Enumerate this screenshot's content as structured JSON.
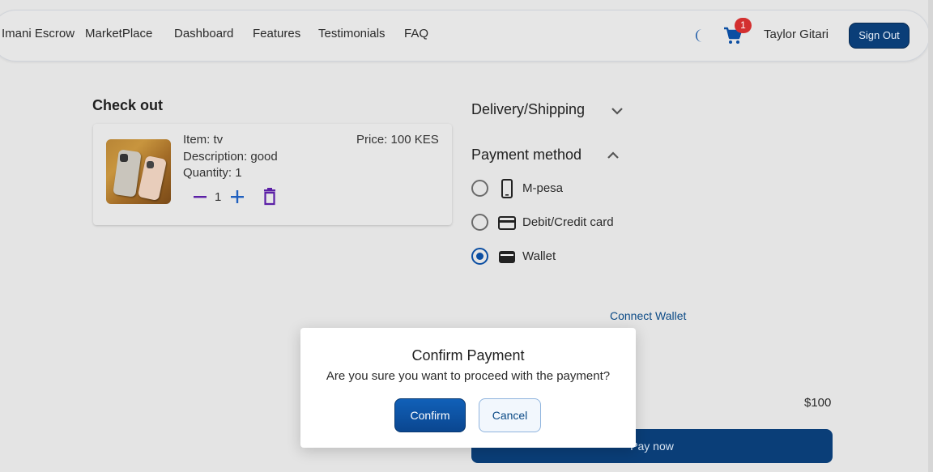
{
  "navbar": {
    "brand": "Imani Escrow",
    "links": [
      "MarketPlace",
      "Dashboard",
      "Features",
      "Testimonials",
      "FAQ"
    ],
    "cart_count": "1",
    "user_name": "Taylor Gitari",
    "sign_out_label": "Sign Out"
  },
  "checkout": {
    "title": "Check out",
    "item": {
      "name_line": "Item: tv",
      "description_line": "Description: good",
      "quantity_line": "Quantity: 1",
      "price_line": "Price: 100 KES",
      "quantity_value": "1"
    }
  },
  "delivery": {
    "title": "Delivery/Shipping"
  },
  "payment": {
    "title": "Payment method",
    "options": [
      {
        "label": "M-pesa",
        "icon": "phone-icon",
        "selected": false
      },
      {
        "label": "Debit/Credit card",
        "icon": "credit-card-icon",
        "selected": false
      },
      {
        "label": "Wallet",
        "icon": "wallet-icon",
        "selected": true
      }
    ],
    "connect_wallet_label": "Connect Wallet",
    "total_value": "$100",
    "pay_now_label": "Pay now"
  },
  "modal": {
    "title": "Confirm Payment",
    "message": "Are you sure you want to proceed with the payment?",
    "confirm_label": "Confirm",
    "cancel_label": "Cancel"
  },
  "colors": {
    "primary": "#0a3e78",
    "accent_purple": "#5b1fa6",
    "badge": "#d32f2f"
  }
}
